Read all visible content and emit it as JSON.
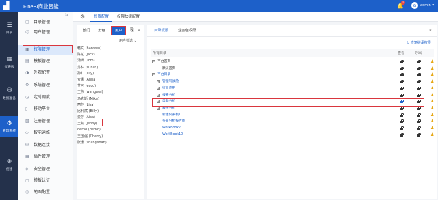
{
  "app": {
    "title": "FineBI商业智能",
    "user": "admin",
    "notification_count": "1",
    "avatar_char": "a"
  },
  "left_nav": [
    {
      "label": "目录",
      "icon": "menu-icon"
    },
    {
      "label": "仪表板",
      "icon": "dashboard-icon"
    },
    {
      "label": "数据准备",
      "icon": "database-icon"
    },
    {
      "label": "管理系统",
      "icon": "gear-icon",
      "active": true
    },
    {
      "label": "创建",
      "icon": "plus-icon"
    }
  ],
  "sidebar": {
    "items": [
      {
        "label": "目录管理"
      },
      {
        "label": "用户管理"
      },
      {
        "label": "权限管理",
        "active": true
      },
      {
        "label": "模板管理"
      },
      {
        "label": "外观配置"
      },
      {
        "label": "系统管理"
      },
      {
        "label": "定时调度"
      },
      {
        "label": "移动平台"
      },
      {
        "label": "注册管理"
      },
      {
        "label": "智能运维"
      },
      {
        "label": "数据连接"
      },
      {
        "label": "插件管理"
      },
      {
        "label": "安全管理"
      },
      {
        "label": "模板认证"
      },
      {
        "label": "地图配置"
      }
    ]
  },
  "tabs": [
    {
      "label": "权限配置",
      "active": true
    },
    {
      "label": "权限快捷配置"
    }
  ],
  "user_panel": {
    "tabs": [
      {
        "label": "部门"
      },
      {
        "label": "角色"
      },
      {
        "label": "用户",
        "active": true
      }
    ],
    "filter_label": "用户筛选",
    "users": [
      "韩文 (hanwen)",
      "陈斌 (Jack)",
      "汤姆 (Tom)",
      "苏林 (sunlin)",
      "孙红 (Lily)",
      "安娜 (Anna)",
      "艾可 (ecco)",
      "王伟 (wangwei)",
      "马克斯 (Mike)",
      "丽莎 (Lisa)",
      "比利斌 (Billy)",
      "爱莎 (Aisa)",
      "王燕 (Jenny)",
      "demo (demo)",
      "王国强 (Cherry)",
      "张珊 (zhangshan)"
    ]
  },
  "perm_panel": {
    "tabs": [
      {
        "label": "目录权限",
        "active": true
      },
      {
        "label": "业务包权限"
      }
    ],
    "restore_label": "恢复继承权限",
    "columns": {
      "name": "所有目录",
      "view": "查看",
      "export": "导出"
    },
    "rows": [
      {
        "name": "平台首页",
        "level": 0,
        "toggle": "−",
        "blue": false
      },
      {
        "name": "默认首页",
        "level": 1,
        "toggle": "",
        "blue": false
      },
      {
        "name": "平台目录",
        "level": 0,
        "toggle": "−",
        "blue": true
      },
      {
        "name": "管理驾驶舱",
        "level": 1,
        "toggle": "+",
        "blue": true
      },
      {
        "name": "行业应用",
        "level": 1,
        "toggle": "+",
        "blue": true
      },
      {
        "name": "报表分析",
        "level": 1,
        "toggle": "+",
        "blue": true
      },
      {
        "name": "自助分析",
        "level": 1,
        "toggle": "+",
        "blue": true,
        "highlight": true
      },
      {
        "name": "表格分析",
        "level": 1,
        "toggle": "+",
        "blue": true
      },
      {
        "name": "新建仪表板1",
        "level": 1,
        "toggle": "",
        "blue": true
      },
      {
        "name": "多变分析报告图",
        "level": 1,
        "toggle": "",
        "blue": true
      },
      {
        "name": "WorkBook7",
        "level": 1,
        "toggle": "",
        "blue": true
      },
      {
        "name": "WorkBook10",
        "level": 1,
        "toggle": "",
        "blue": true
      }
    ]
  }
}
